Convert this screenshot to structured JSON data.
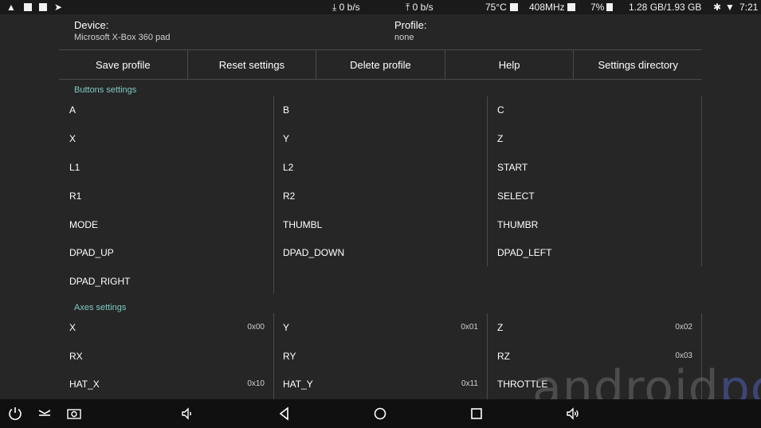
{
  "status_bar": {
    "download_speed": "0 b/s",
    "upload_speed": "0 b/s",
    "temperature": "75°C",
    "cpu_freq": "408MHz",
    "battery": "7%",
    "memory": "1.28 GB/1.93 GB",
    "time": "7:21"
  },
  "device": {
    "label": "Device:",
    "value": "Microsoft X-Box 360 pad"
  },
  "profile": {
    "label": "Profile:",
    "value": "none"
  },
  "toolbar": {
    "save_label": "Save profile",
    "reset_label": "Reset settings",
    "delete_label": "Delete profile",
    "help_label": "Help",
    "settings_dir_label": "Settings directory"
  },
  "buttons_section": {
    "title": "Buttons settings",
    "items": [
      "A",
      "B",
      "C",
      "X",
      "Y",
      "Z",
      "L1",
      "L2",
      "START",
      "R1",
      "R2",
      "SELECT",
      "MODE",
      "THUMBL",
      "THUMBR",
      "DPAD_UP",
      "DPAD_DOWN",
      "DPAD_LEFT",
      "DPAD_RIGHT"
    ]
  },
  "axes_section": {
    "title": "Axes settings",
    "items": [
      {
        "name": "X",
        "code": "0x00"
      },
      {
        "name": "Y",
        "code": "0x01"
      },
      {
        "name": "Z",
        "code": "0x02"
      },
      {
        "name": "RX",
        "code": ""
      },
      {
        "name": "RY",
        "code": ""
      },
      {
        "name": "RZ",
        "code": "0x03"
      },
      {
        "name": "HAT_X",
        "code": "0x10"
      },
      {
        "name": "HAT_Y",
        "code": "0x11"
      },
      {
        "name": "THROTTLE",
        "code": ""
      }
    ]
  },
  "watermark": {
    "main": "android",
    "accent": "pc"
  }
}
